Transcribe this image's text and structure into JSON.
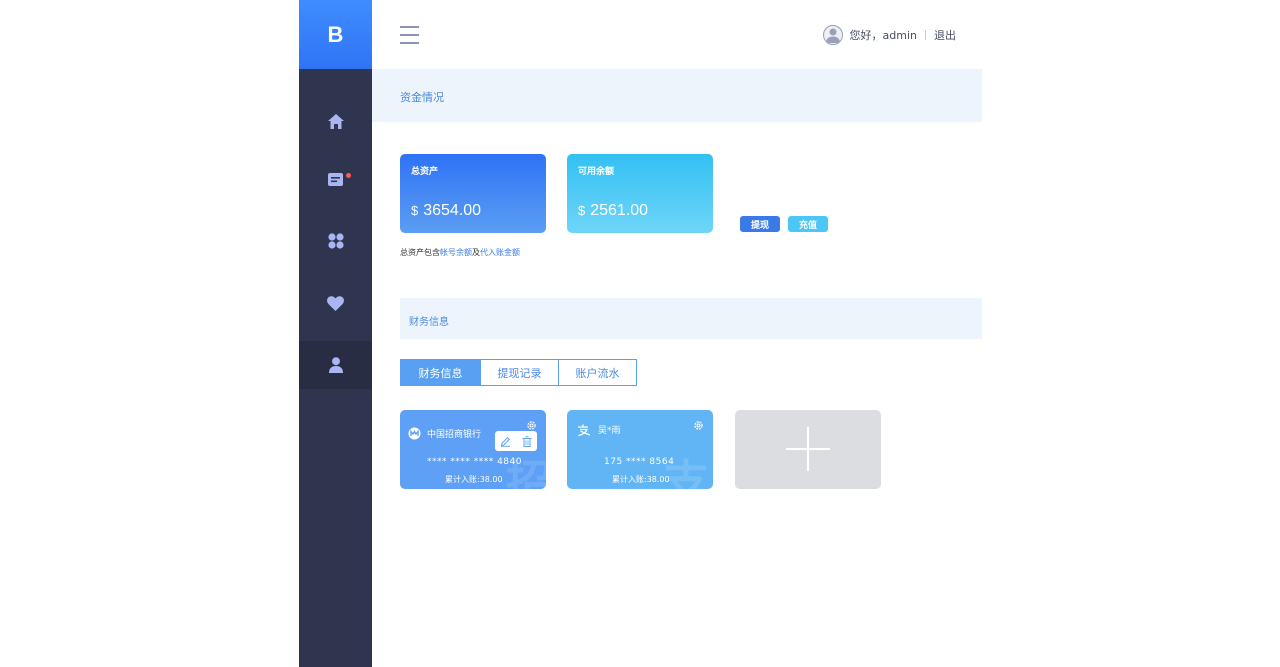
{
  "sidebar": {
    "logo": "B",
    "items": [
      {
        "icon": "home-icon"
      },
      {
        "icon": "message-icon",
        "has_badge": true
      },
      {
        "icon": "apps-icon"
      },
      {
        "icon": "heart-icon"
      },
      {
        "icon": "user-icon",
        "active": true
      }
    ]
  },
  "header": {
    "greeting": "您好，admin",
    "logout": "退出"
  },
  "funds": {
    "section_title": "资金情况",
    "total": {
      "label": "总资产",
      "currency": "$",
      "amount": "3654.00"
    },
    "available": {
      "label": "可用余额",
      "currency": "$",
      "amount": "2561.00"
    },
    "withdraw_button": "提现",
    "recharge_button": "充值",
    "note_prefix": "总资产包含",
    "note_link1": "帐号余额",
    "note_mid": "及",
    "note_link2": "代入账金额"
  },
  "finance": {
    "section_title": "财务信息",
    "tabs": [
      "财务信息",
      "提现记录",
      "账户流水"
    ],
    "active_tab": 0,
    "cards": [
      {
        "name": "中国招商银行",
        "number": "****  ****  ****    4840",
        "total": "累计入账:38.00",
        "icon": "bank-logo-icon",
        "watermark": "招"
      },
      {
        "name": "吴*雨",
        "number": "175  ****  8564",
        "total": "累计入账:38.00",
        "icon": "alipay-icon",
        "watermark": "支"
      }
    ]
  },
  "colors": {
    "sidebar_bg": "#2f354f",
    "accent_blue": "#3a7ae6",
    "total_card_gradient": [
      "#2f72f6",
      "#5b9ef3"
    ],
    "available_card_gradient": [
      "#33c0f3",
      "#6fd5f8"
    ],
    "section_bg": "#eef4fb"
  }
}
